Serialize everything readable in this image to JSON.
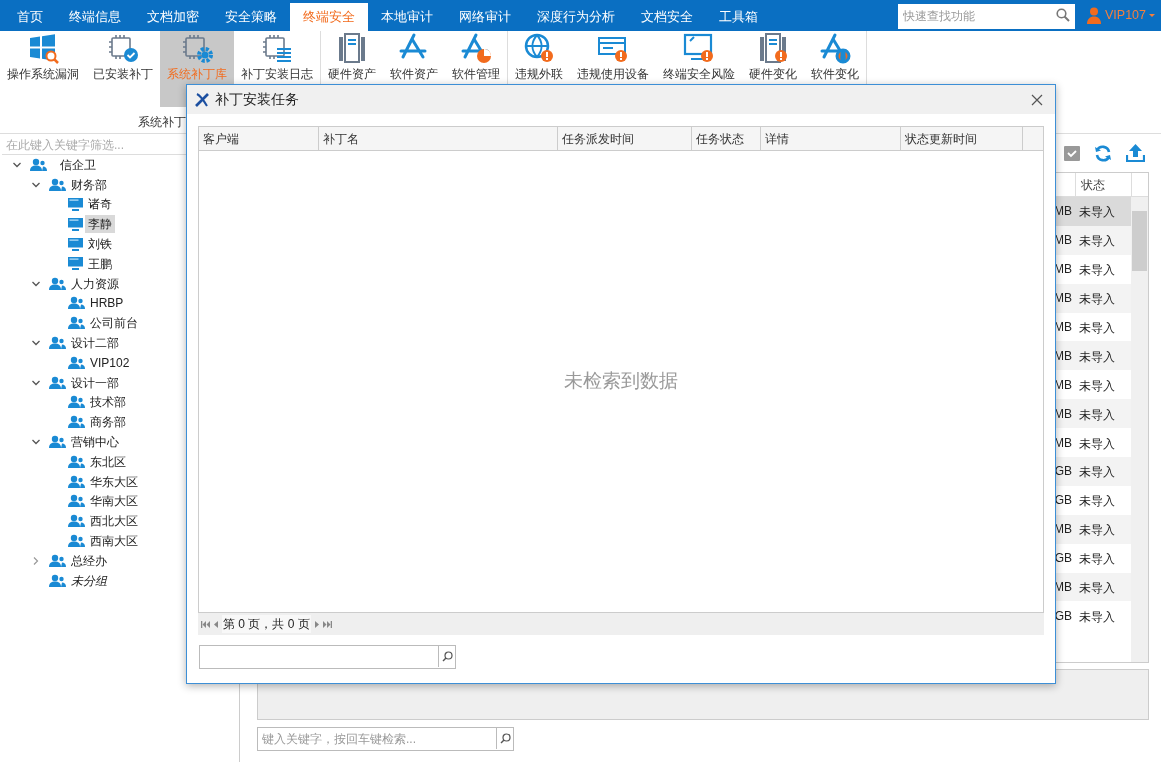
{
  "nav": {
    "tabs": [
      {
        "label": "首页",
        "selected": false
      },
      {
        "label": "终端信息",
        "selected": false
      },
      {
        "label": "文档加密",
        "selected": false
      },
      {
        "label": "安全策略",
        "selected": false
      },
      {
        "label": "终端安全",
        "selected": true
      },
      {
        "label": "本地审计",
        "selected": false
      },
      {
        "label": "网络审计",
        "selected": false
      },
      {
        "label": "深度行为分析",
        "selected": false
      },
      {
        "label": "文档安全",
        "selected": false
      },
      {
        "label": "工具箱",
        "selected": false
      }
    ],
    "search": {
      "placeholder": "快速查找功能"
    },
    "user": "VIP107"
  },
  "ribbon": {
    "groups": [
      {
        "label": "系统补丁",
        "items": [
          {
            "label": "操作系统漏洞",
            "kind": "windows",
            "selected": false
          },
          {
            "label": "已安装补丁",
            "kind": "chip-check",
            "selected": false
          },
          {
            "label": "系统补丁库",
            "kind": "chip-gear",
            "selected": true
          },
          {
            "label": "补丁安装日志",
            "kind": "chip-list",
            "selected": false
          }
        ]
      },
      {
        "items": [
          {
            "label": "硬件资产",
            "kind": "server",
            "selected": false
          },
          {
            "label": "软件资产",
            "kind": "app",
            "selected": false
          },
          {
            "label": "软件管理",
            "kind": "app-pie",
            "selected": false
          }
        ]
      },
      {
        "items": [
          {
            "label": "违规外联",
            "kind": "globe-alert",
            "selected": false
          },
          {
            "label": "违规使用设备",
            "kind": "card-alert",
            "selected": false
          },
          {
            "label": "终端安全风险",
            "kind": "monitor-alert",
            "selected": false
          },
          {
            "label": "硬件变化",
            "kind": "server-alert",
            "selected": false
          },
          {
            "label": "软件变化",
            "kind": "app-alert",
            "selected": false
          }
        ]
      }
    ]
  },
  "tree": {
    "filter_placeholder": "在此键入关键字筛选...",
    "items": [
      {
        "label": "信企卫",
        "kind": "group",
        "expanded": true,
        "selected": false,
        "children": [
          {
            "label": "财务部",
            "kind": "group",
            "expanded": true,
            "selected": false,
            "children": [
              {
                "label": "诸奇",
                "kind": "computer",
                "selected": false
              },
              {
                "label": "李静",
                "kind": "computer",
                "selected": true
              },
              {
                "label": "刘铁",
                "kind": "computer",
                "selected": false
              },
              {
                "label": "王鹏",
                "kind": "computer",
                "selected": false
              }
            ]
          },
          {
            "label": "人力资源",
            "kind": "group",
            "expanded": true,
            "selected": false,
            "children": [
              {
                "label": "HRBP",
                "kind": "group",
                "selected": false
              },
              {
                "label": "公司前台",
                "kind": "group",
                "selected": false
              }
            ]
          },
          {
            "label": "设计二部",
            "kind": "group",
            "expanded": true,
            "selected": false,
            "children": [
              {
                "label": "VIP102",
                "kind": "group",
                "selected": false
              }
            ]
          },
          {
            "label": "设计一部",
            "kind": "group",
            "expanded": true,
            "selected": false,
            "children": [
              {
                "label": "技术部",
                "kind": "group",
                "selected": false
              },
              {
                "label": "商务部",
                "kind": "group",
                "selected": false
              }
            ]
          },
          {
            "label": "营销中心",
            "kind": "group",
            "expanded": true,
            "selected": false,
            "children": [
              {
                "label": "东北区",
                "kind": "group",
                "selected": false
              },
              {
                "label": "华东大区",
                "kind": "group",
                "selected": false
              },
              {
                "label": "华南大区",
                "kind": "group",
                "selected": false
              },
              {
                "label": "西北大区",
                "kind": "group",
                "selected": false
              },
              {
                "label": "西南大区",
                "kind": "group",
                "selected": false
              }
            ]
          },
          {
            "label": "总经办",
            "kind": "group",
            "expanded": false,
            "selected": false
          },
          {
            "label": "未分组",
            "kind": "ungrouped",
            "selected": false
          }
        ]
      }
    ]
  },
  "patch_table": {
    "status_header": "状态",
    "rows": [
      {
        "size": "MB",
        "status": "未导入",
        "selected": true
      },
      {
        "size": "MB",
        "status": "未导入",
        "selected": false
      },
      {
        "size": "MB",
        "status": "未导入",
        "selected": false
      },
      {
        "size": "MB",
        "status": "未导入",
        "selected": false
      },
      {
        "size": "MB",
        "status": "未导入",
        "selected": false
      },
      {
        "size": "MB",
        "status": "未导入",
        "selected": false
      },
      {
        "size": "MB",
        "status": "未导入",
        "selected": false
      },
      {
        "size": "MB",
        "status": "未导入",
        "selected": false
      },
      {
        "size": "MB",
        "status": "未导入",
        "selected": false
      },
      {
        "size": "GB",
        "status": "未导入",
        "selected": false
      },
      {
        "size": "GB",
        "status": "未导入",
        "selected": false
      },
      {
        "size": "MB",
        "status": "未导入",
        "selected": false
      },
      {
        "size": "GB",
        "status": "未导入",
        "selected": false
      },
      {
        "size": "MB",
        "status": "未导入",
        "selected": false
      },
      {
        "size": "GB",
        "status": "未导入",
        "selected": false
      }
    ]
  },
  "bottom_search": {
    "placeholder": "键入关键字，按回车键检索..."
  },
  "dialog": {
    "title": "补丁安装任务",
    "columns": [
      "客户端",
      "补丁名",
      "任务派发时间",
      "任务状态",
      "详情",
      "状态更新时间"
    ],
    "empty_message": "未检索到数据",
    "pager": "第 0 页，共 0 页"
  }
}
